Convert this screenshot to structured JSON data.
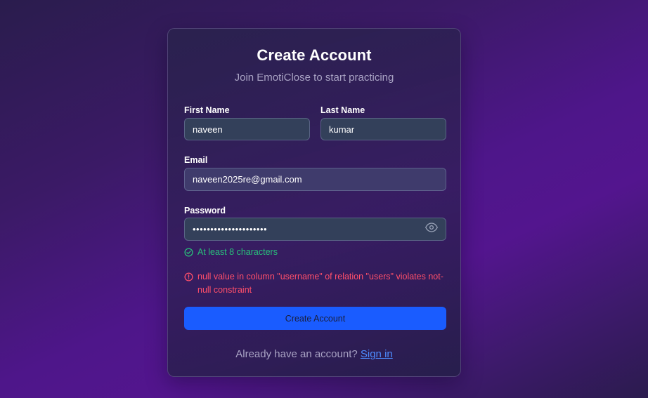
{
  "form": {
    "title": "Create Account",
    "subtitle": "Join EmotiClose to start practicing",
    "first_name": {
      "label": "First Name",
      "value": "naveen"
    },
    "last_name": {
      "label": "Last Name",
      "value": "kumar"
    },
    "email": {
      "label": "Email",
      "value": "naveen2025re@gmail.com"
    },
    "password": {
      "label": "Password",
      "value": "•••••••••••••••••••••",
      "toggle_icon": "eye-icon"
    },
    "hint": {
      "text": "At least 8 characters",
      "icon": "check-circle-icon",
      "color": "#28c27a"
    },
    "error": {
      "text": "null value in column \"username\" of relation \"users\" violates not-null constraint",
      "icon": "alert-circle-icon",
      "color": "#ff4f6a"
    },
    "submit_label": "Create Account",
    "footer": {
      "prompt": "Already have an account?",
      "link": "Sign in"
    }
  },
  "colors": {
    "accent": "#1a5cff",
    "link": "#4d8cff",
    "input_bg": "#33405a"
  }
}
